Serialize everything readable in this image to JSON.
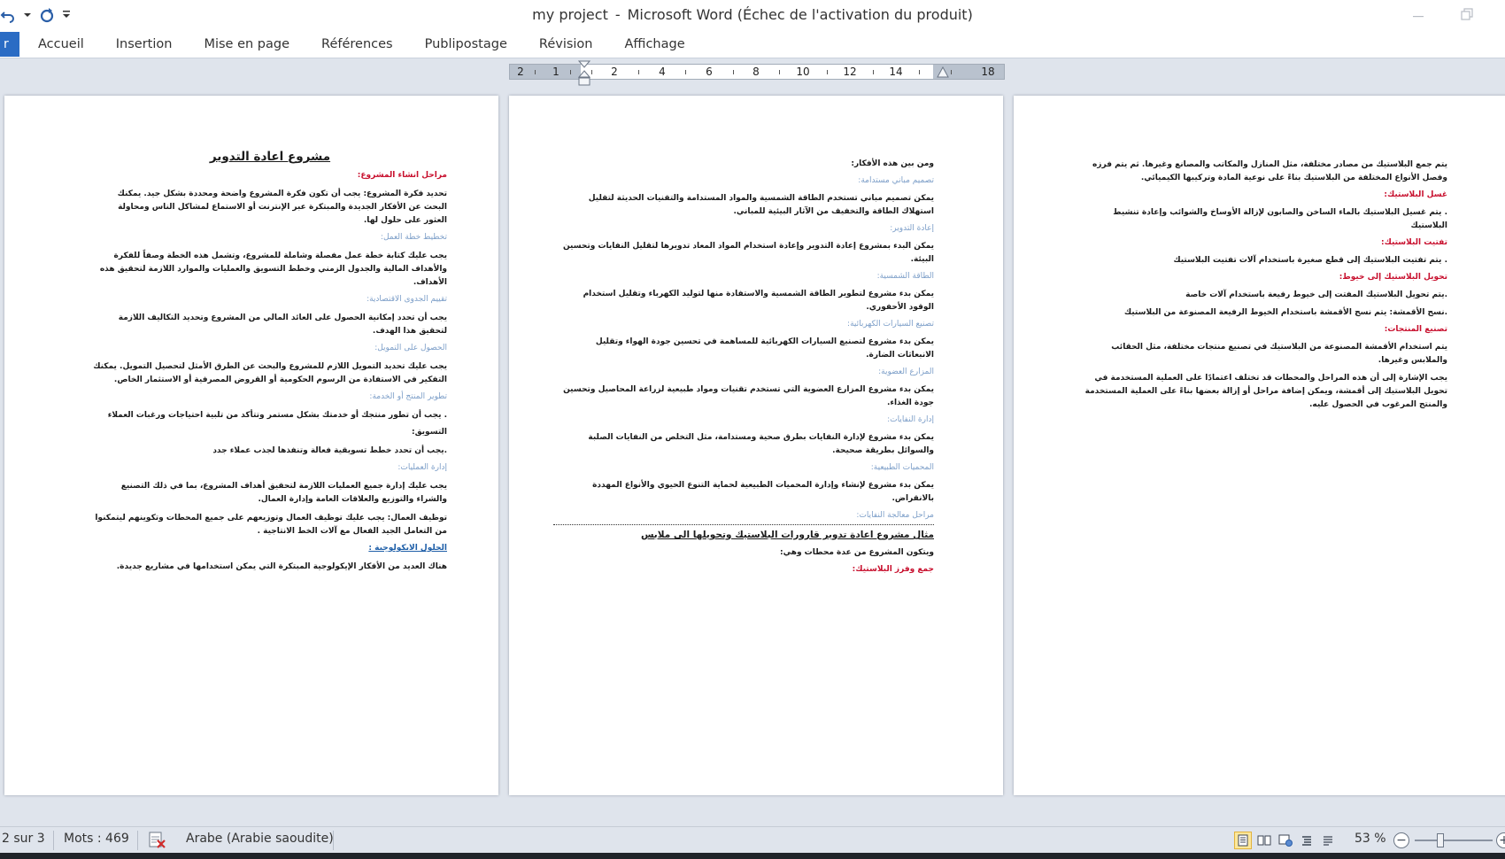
{
  "window": {
    "document_name": "my project",
    "app_name": "Microsoft Word (Échec de l'activation du produit)",
    "separator": "-"
  },
  "quick_access": {
    "icons": [
      "undo-icon",
      "dropdown-arrow-icon",
      "redo-icon",
      "customize-qat-icon"
    ]
  },
  "ribbon": {
    "file_label": "r",
    "tabs": [
      "Accueil",
      "Insertion",
      "Mise en page",
      "Références",
      "Publipostage",
      "Révision",
      "Affichage"
    ]
  },
  "ruler": {
    "labels": [
      "2",
      "1",
      "2",
      "4",
      "6",
      "8",
      "10",
      "12",
      "14",
      "18"
    ]
  },
  "pages": {
    "page1": {
      "title": "مشروع اعادة التدوير",
      "blocks": [
        {
          "style": "h-red",
          "text": "مراحل انشاء المشروع:"
        },
        {
          "style": "para",
          "text": "تحديد فكرة المشروع: يجب أن تكون فكرة المشروع واضحة ومحددة بشكل جيد. يمكنك البحث عن الأفكار الجديدة والمبتكرة عبر الإنترنت أو الاستماع لمشاكل الناس ومحاولة العثور على حلول لها."
        },
        {
          "style": "h-blue",
          "text": "تخطيط خطة العمل:"
        },
        {
          "style": "para",
          "text": "يجب عليك كتابة خطة عمل مفصلة وشاملة للمشروع، وتشمل هذه الخطة وصفاً للفكرة والأهداف المالية والجدول الزمني وخطط التسويق والعمليات والموارد اللازمة لتحقيق هذه الأهداف."
        },
        {
          "style": "h-blue",
          "text": "تقييم الجدوى الاقتصادية:"
        },
        {
          "style": "para",
          "text": "يجب أن تحدد إمكانية الحصول على العائد المالي من المشروع وتحديد التكاليف اللازمة لتحقيق هذا الهدف."
        },
        {
          "style": "h-blue",
          "text": "الحصول على التمويل:"
        },
        {
          "style": "para",
          "text": "يجب عليك تحديد التمويل اللازم للمشروع والبحث عن الطرق الأمثل لتحصيل التمويل. يمكنك التفكير في الاستفادة من الرسوم الحكومية أو القروض المصرفية أو الاستثمار الخاص."
        },
        {
          "style": "h-blue",
          "text": "تطوير المنتج أو الخدمة:"
        },
        {
          "style": "para",
          "text": ". يجب أن تطور منتجك أو خدمتك بشكل مستمر وتتأكد من تلبية احتياجات ورغبات العملاء"
        },
        {
          "style": "h-black",
          "text": "التسويق:"
        },
        {
          "style": "para",
          "text": ".يجب أن تحدد خطط تسويقية فعالة وتنفذها لجذب عملاء جدد"
        },
        {
          "style": "h-blue",
          "text": "إدارة العمليات:"
        },
        {
          "style": "para",
          "text": "يجب عليك إدارة جميع العمليات اللازمة لتحقيق أهداف المشروع، بما في ذلك التصنيع والشراء والتوزيع والعلاقات العامة وإدارة العمال."
        },
        {
          "style": "para",
          "text": "توظيف العمال: يجب عليك توظيف العمال وتوزيعهم على جميع المحطات وتكوينهم ليتمكنوا من التعامل الجيد الفعال مع آلات الخط الانتاجية ."
        },
        {
          "style": "h-blue-u",
          "text": "الحلول الايكولوجية :"
        },
        {
          "style": "para",
          "text": "هناك العديد من الأفكار الإيكولوجية المبتكرة التي يمكن استخدامها في مشاريع جديدة."
        }
      ]
    },
    "page2": {
      "blocks": [
        {
          "style": "h-black",
          "text": "ومن بين هذه الأفكار:"
        },
        {
          "style": "h-blue",
          "text": "تصميم مباني مستدامة:"
        },
        {
          "style": "para",
          "text": "يمكن تصميم مباني تستخدم الطاقة الشمسية والمواد المستدامة والتقنيات الحديثة لتقليل استهلاك الطاقة والتخفيف من الآثار البيئية للمباني."
        },
        {
          "style": "h-blue",
          "text": "إعادة التدوير:"
        },
        {
          "style": "para",
          "text": "يمكن البدء بمشروع إعادة التدوير وإعادة استخدام المواد المعاد تدويرها لتقليل النفايات وتحسين البيئة."
        },
        {
          "style": "h-blue",
          "text": "الطاقة الشمسية:"
        },
        {
          "style": "para",
          "text": "يمكن بدء مشروع لتطوير الطاقة الشمسية والاستفادة منها لتوليد الكهرباء وتقليل استخدام الوقود الأحفوري."
        },
        {
          "style": "h-blue",
          "text": "تصنيع السيارات الكهربائية:"
        },
        {
          "style": "para",
          "text": "يمكن بدء مشروع لتصنيع السيارات الكهربائية للمساهمة في تحسين جودة الهواء وتقليل الانبعاثات الضارة."
        },
        {
          "style": "h-blue",
          "text": "المزارع العضوية:"
        },
        {
          "style": "para",
          "text": "يمكن بدء مشروع المزارع العضوية التي تستخدم تقنيات ومواد طبيعية لزراعة المحاصيل وتحسين جودة الغذاء."
        },
        {
          "style": "h-blue",
          "text": "إدارة النفايات:"
        },
        {
          "style": "para",
          "text": "يمكن بدء مشروع لإدارة النفايات بطرق صحية ومستدامة، مثل التخلص من النفايات الصلبة والسوائل بطريقة صحيحة."
        },
        {
          "style": "h-blue",
          "text": "المحميات الطبيعية:"
        },
        {
          "style": "para",
          "text": "يمكن بدء مشروع لإنشاء وإدارة المحميات الطبيعية لحماية التنوع الحيوي والأنواع المهددة بالانقراض."
        },
        {
          "style": "h-blue",
          "text": "مراحل معالجة النفايات:"
        },
        {
          "style": "dotted",
          "text": ""
        },
        {
          "style": "h-black-u",
          "text": "مثال مشروع اعادة تدوير قارورات البلاستيك وتحويلها الى ملابس"
        },
        {
          "style": "para",
          "text": "ويتكون المشروع من عدة محطات وهي:"
        },
        {
          "style": "h-red",
          "text": "جمع وفرز البلاستيك:"
        }
      ]
    },
    "page3": {
      "blocks": [
        {
          "style": "para",
          "text": "يتم جمع البلاستيك من مصادر مختلفة، مثل المنازل والمكاتب والمصانع وغيرها. ثم يتم فرزه وفصل الأنواع المختلفة من البلاستيك بناءً على نوعية المادة وتركيبها الكيميائي."
        },
        {
          "style": "h-red",
          "text": "غسل البلاستيك:"
        },
        {
          "style": "para",
          "text": ". يتم غسيل البلاستيك بالماء الساخن والصابون لإزالة الأوساخ والشوائب وإعادة تنشيط البلاستيك"
        },
        {
          "style": "h-red",
          "text": "تفتيت البلاستيك:"
        },
        {
          "style": "para",
          "text": ". يتم تفتيت البلاستيك إلى قطع صغيرة باستخدام آلات تفتيت البلاستيك"
        },
        {
          "style": "h-red",
          "text": "تحويل البلاستيك إلى خيوط:"
        },
        {
          "style": "para",
          "text": ".يتم تحويل البلاستيك المفتت إلى خيوط رفيعة باستخدام آلات خاصة"
        },
        {
          "style": "para",
          "text": ".نسج الأقمشة: يتم نسج الأقمشة باستخدام الخيوط الرفيعة المصنوعة من البلاستيك"
        },
        {
          "style": "h-red",
          "text": "تصنيع المنتجات:"
        },
        {
          "style": "para",
          "text": "يتم استخدام الأقمشة المصنوعة من البلاستيك في تصنيع منتجات مختلفة، مثل الحقائب والملابس وغيرها."
        },
        {
          "style": "para",
          "text": "يجب الإشارة إلى أن هذه المراحل والمحطات قد تختلف اعتمادًا على العملية المستخدمة في تحويل البلاستيك إلى أقمشة، ويمكن إضافة مراحل أو إزالة بعضها بناءً على العملية المستخدمة والمنتج المرغوب في الحصول عليه."
        }
      ]
    }
  },
  "statusbar": {
    "page_info": "2 sur 3",
    "word_count": "Mots : 469",
    "language": "Arabe (Arabie saoudite)",
    "zoom": "53 %",
    "zoom_minus": "−",
    "zoom_plus": "+",
    "proofing_icon": "proofing-error-icon",
    "view_icons": [
      "print-layout-icon",
      "full-reading-icon",
      "web-layout-icon",
      "outline-icon",
      "draft-icon"
    ]
  }
}
